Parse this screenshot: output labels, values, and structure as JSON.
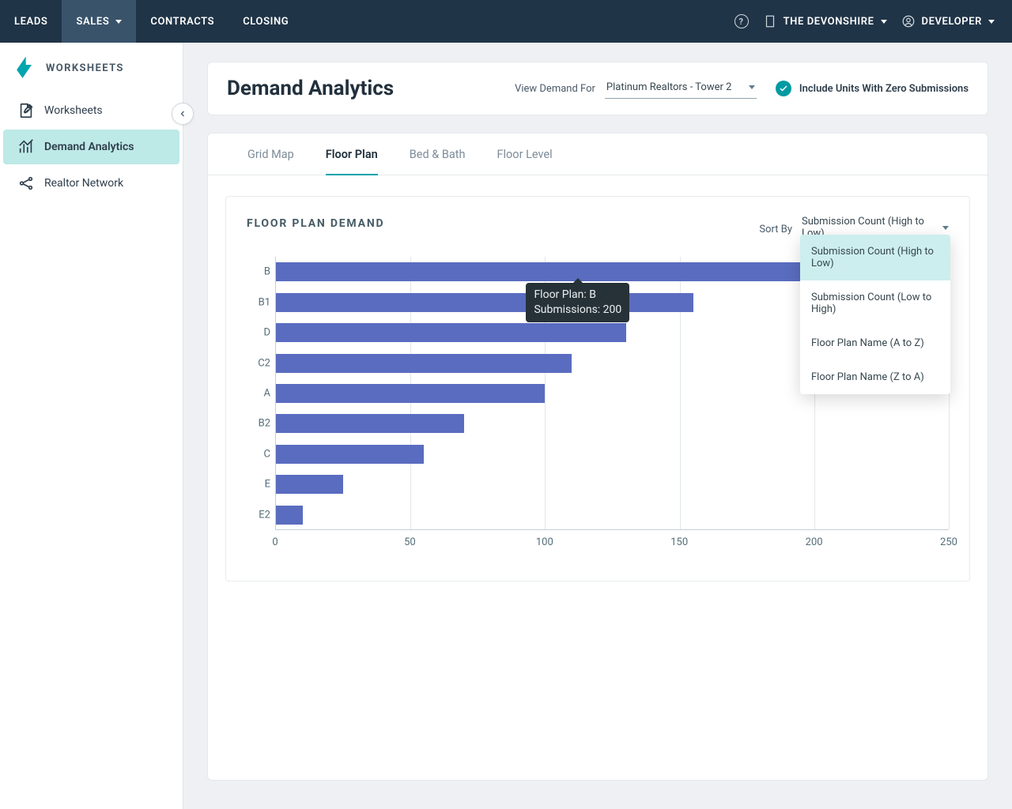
{
  "topnav": {
    "items": [
      {
        "label": "LEADS"
      },
      {
        "label": "SALES",
        "hasDropdown": true,
        "active": true
      },
      {
        "label": "CONTRACTS"
      },
      {
        "label": "CLOSING"
      }
    ],
    "project_label": "THE DEVONSHIRE",
    "user_label": "DEVELOPER"
  },
  "sidebar": {
    "title": "WORKSHEETS",
    "items": [
      {
        "label": "Worksheets"
      },
      {
        "label": "Demand Analytics",
        "active": true
      },
      {
        "label": "Realtor Network"
      }
    ]
  },
  "header": {
    "title": "Demand Analytics",
    "view_for_label": "View Demand For",
    "view_for_value": "Platinum Realtors - Tower 2",
    "include_zero_label": "Include Units With Zero Submissions"
  },
  "tabs": [
    {
      "label": "Grid Map"
    },
    {
      "label": "Floor Plan",
      "active": true
    },
    {
      "label": "Bed & Bath"
    },
    {
      "label": "Floor Level"
    }
  ],
  "panel": {
    "title": "FLOOR PLAN DEMAND",
    "sort_label": "Sort By",
    "sort_value": "Submission Count (High to Low)"
  },
  "sort_options": [
    {
      "label": "Submission Count (High to Low)",
      "selected": true
    },
    {
      "label": "Submission Count (Low to High)"
    },
    {
      "label": "Floor Plan Name (A to Z)"
    },
    {
      "label": "Floor Plan Name (Z to A)"
    }
  ],
  "tooltip": {
    "line1": "Floor Plan: B",
    "line2": "Submissions: 200"
  },
  "chart_data": {
    "type": "bar",
    "orientation": "horizontal",
    "title": "FLOOR PLAN DEMAND",
    "xlabel": "",
    "ylabel": "",
    "xlim": [
      0,
      250
    ],
    "xticks": [
      0,
      50,
      100,
      150,
      200,
      250
    ],
    "categories": [
      "B",
      "B1",
      "D",
      "C2",
      "A",
      "B2",
      "C",
      "E",
      "E2"
    ],
    "values": [
      200,
      155,
      130,
      110,
      100,
      70,
      55,
      25,
      10
    ]
  }
}
